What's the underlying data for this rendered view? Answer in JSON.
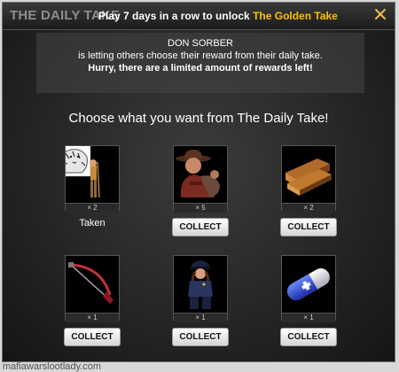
{
  "header": {
    "title": "THE DAILY TAKE",
    "subtitle_prefix": "Play 7 days in a row to unlock ",
    "subtitle_highlight": "The Golden Take"
  },
  "notice": {
    "line1": "DON SORBER",
    "line2": "is letting others choose their reward from their daily take.",
    "line3": "Hurry, there are a limited amount of rewards left!"
  },
  "prompt": "Choose what you want from The Daily Take!",
  "rewards": [
    {
      "icon": "white-tiger-with-fighter-icon",
      "qty": "× 2",
      "status": "Taken"
    },
    {
      "icon": "cowboy-hat-man-icon",
      "qty": "× 5",
      "button": "COLLECT"
    },
    {
      "icon": "lumber-planks-icon",
      "qty": "× 2",
      "button": "COLLECT"
    },
    {
      "icon": "hacksaw-icon",
      "qty": "× 1",
      "button": "COLLECT"
    },
    {
      "icon": "police-woman-icon",
      "qty": "× 1",
      "button": "COLLECT"
    },
    {
      "icon": "medical-capsule-icon",
      "qty": "× 1",
      "button": "COLLECT"
    }
  ],
  "footer": "mafiawarslootlady.com",
  "colors": {
    "accent": "#ffc000",
    "background": "#2a2a2a"
  }
}
